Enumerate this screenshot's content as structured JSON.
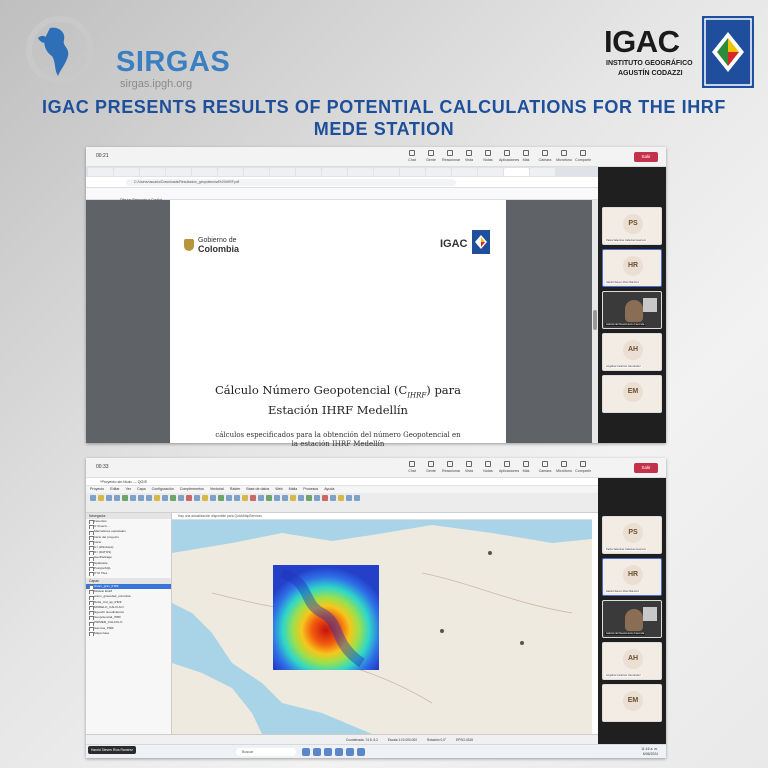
{
  "header": {
    "sirgas_name": "SIRGAS",
    "sirgas_url": "sirgas.ipgh.org",
    "igac_name": "IGAC",
    "igac_subtitle_line1": "INSTITUTO GEOGRÁFICO",
    "igac_subtitle_line2": "AGUSTÍN CODAZZI",
    "headline": "IGAC PRESENTS RESULTS OF POTENTIAL CALCULATIONS FOR THE IHRF MEDE STATION"
  },
  "colors": {
    "headline": "#1e4f9a",
    "sirgas_blue": "#3a7fc1",
    "leave_button": "#c4314b"
  },
  "meeting": {
    "leave_label": "Salir",
    "actions": [
      "Chat",
      "Gente",
      "Reaccionar",
      "Vista",
      "Notas",
      "Aplicaciones",
      "Más",
      "Cámara",
      "Micrófono",
      "Compartir"
    ],
    "participants": [
      {
        "initials": "PS",
        "name": "Paola Valentina Cabezas Guerrero"
      },
      {
        "initials": "HR",
        "name": "Harold Steven Ríos Ramírez"
      },
      {
        "initials": "",
        "name": "Gabriel del Nascimiento Fazenda"
      },
      {
        "initials": "AH",
        "name": "Angélica Gutiérrez Hernández"
      },
      {
        "initials": "EM",
        "name": ""
      }
    ]
  },
  "shot1": {
    "time": "00:21",
    "url": "C:/Users/usuario/Downloads/Resultados_geopotencial%20IHRF.pdf",
    "pdf_toolbar_text": "Dibujar   Pregunta a Copilot",
    "gov_label_line1": "Gobierno de",
    "gov_label_line2": "Colombia",
    "igac_mini": "IGAC",
    "doc_title_line1": "Cálculo Número Geopotencial (C",
    "doc_title_sub": "IHRF",
    "doc_title_line1_end": ") para",
    "doc_title_line2": "Estación IHRF Medellín",
    "doc_sub_line1": "cálculos especificados para la obtención del número Geopotencial en",
    "doc_sub_line2": "la estación IHRF Medellín"
  },
  "shot2": {
    "time": "00:33",
    "qgis_title": "*Proyecto sin título — QGIS",
    "menus": [
      "Proyecto",
      "Editar",
      "Ver",
      "Capa",
      "Configuración",
      "Complementos",
      "Vectorial",
      "Ráster",
      "Base de datos",
      "Web",
      "Malla",
      "Procesos",
      "Ayuda"
    ],
    "message": "Hay una actualización disponible para QuickMapServices",
    "panel_browser": "Navegador",
    "panel_layers": "Capas",
    "browser_items": [
      "Favoritos",
      "C:/Users/...",
      "Marcadores espaciales",
      "Inicio del proyecto",
      "Inicio",
      "C:\\ (Windows)",
      "D:\\ (DATOS)",
      "GeoPackage",
      "SpatiaLite",
      "PostgreSQL",
      "XYZ Tiles"
    ],
    "layer_items": [
      "Anom_grav_IHRF",
      "Modelo EGM",
      "anom_gravedad_colombia",
      "Delta_Cid_ap_IHRF",
      "MODELO_CALCULO",
      "Ngeodtr Geodinámico",
      "Geopotencial_IHRF",
      "PRIMER_CALCULO",
      "Gamma_IHRF",
      "Mapa base"
    ],
    "status_coord": "Coordenada -74.5, 6.2",
    "status_scale": "Escala 1:10.000.000",
    "status_rotation": "Rotación 0,0°",
    "status_crs": "EPSG:4326",
    "search_label": "Buscar",
    "clock_time": "11:16 a. m.",
    "clock_date": "6/06/2024",
    "user_chip": "Harold Steven Ríos Ramírez"
  }
}
